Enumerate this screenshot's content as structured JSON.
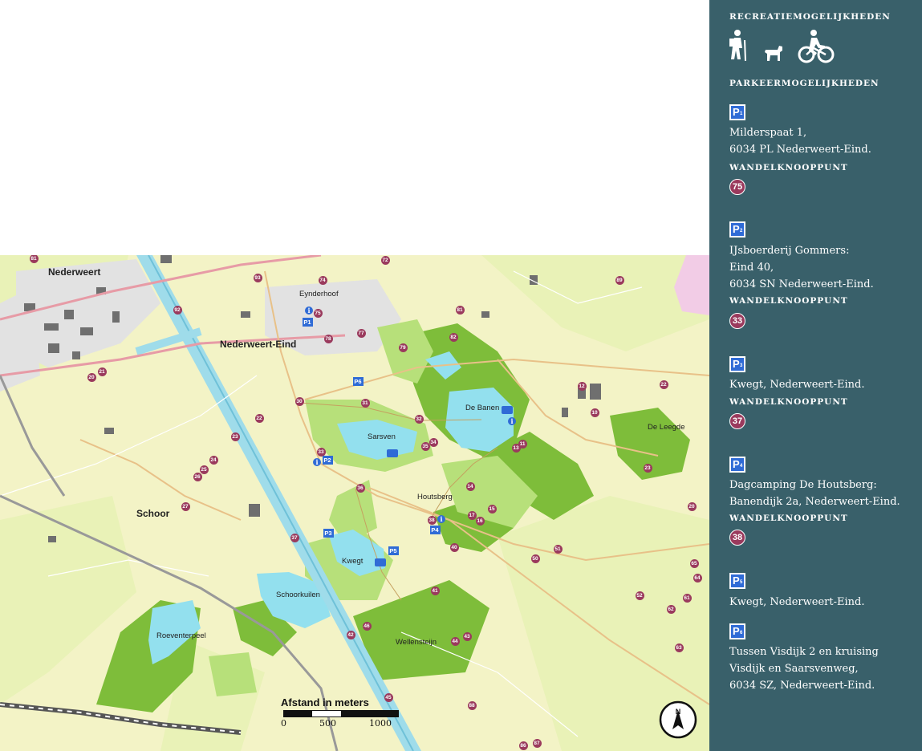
{
  "map": {
    "places": [
      {
        "id": "nederweert",
        "label": "Nederweert"
      },
      {
        "id": "nederweert-eind",
        "label": "Nederweert-Eind"
      },
      {
        "id": "schoor",
        "label": "Schoor"
      },
      {
        "id": "eynderhoof",
        "label": "Eynderhoof"
      },
      {
        "id": "de-banen",
        "label": "De Banen"
      },
      {
        "id": "sarsven",
        "label": "Sarsven"
      },
      {
        "id": "houtsberg",
        "label": "Houtsberg"
      },
      {
        "id": "de-leegde",
        "label": "De Leegde"
      },
      {
        "id": "kwegt",
        "label": "Kwegt"
      },
      {
        "id": "schoorkuilen",
        "label": "Schoorkuilen"
      },
      {
        "id": "roeventerpeel",
        "label": "Roeventerpeel"
      },
      {
        "id": "wellensteijn",
        "label": "Wellensteijn"
      }
    ],
    "nodes": [
      "81",
      "72",
      "93",
      "74",
      "92",
      "75",
      "89",
      "77",
      "78",
      "81",
      "82",
      "79",
      "21",
      "20",
      "31",
      "30",
      "22",
      "32",
      "35",
      "34",
      "33",
      "23",
      "24",
      "25",
      "26",
      "36",
      "27",
      "37",
      "38",
      "40",
      "41",
      "46",
      "42",
      "44",
      "43",
      "45",
      "14",
      "17",
      "16",
      "15",
      "12",
      "10",
      "22",
      "23",
      "13",
      "11",
      "20",
      "51",
      "50",
      "65",
      "52",
      "61",
      "62",
      "64",
      "63",
      "88",
      "86",
      "87",
      "86"
    ],
    "parking_labels": [
      "P1",
      "P6",
      "P2",
      "P3",
      "P5",
      "P4"
    ],
    "scale": {
      "title": "Afstand in meters",
      "ticks": [
        "0",
        "500",
        "1000"
      ]
    },
    "north_label": "N"
  },
  "panel": {
    "recreation_heading": "RECREATIEMOGELIJKHEDEN",
    "recreation_icons": [
      "hiking-icon",
      "dog-walking-icon",
      "cycling-icon"
    ],
    "parking_heading": "PARKEERMOGELIJKHEDEN",
    "node_heading": "WANDELKNOOPPUNT",
    "parkings": [
      {
        "badge": "P",
        "sub": "1",
        "lines": [
          "Milderspaat 1,",
          "6034 PL Nederweert-Eind."
        ],
        "node": "75"
      },
      {
        "badge": "P",
        "sub": "2",
        "lines": [
          "IJsboerderij Gommers:",
          "Eind 40,",
          "6034 SN Nederweert-Eind."
        ],
        "node": "33"
      },
      {
        "badge": "P",
        "sub": "3",
        "lines": [
          "Kwegt, Nederweert-Eind."
        ],
        "node": "37"
      },
      {
        "badge": "P",
        "sub": "4",
        "lines": [
          "Dagcamping De Houtsberg:",
          "Banendijk 2a, Nederweert-Eind."
        ],
        "node": "38"
      },
      {
        "badge": "P",
        "sub": "5",
        "lines": [
          "Kwegt, Nederweert-Eind."
        ],
        "node": ""
      },
      {
        "badge": "P",
        "sub": "6",
        "lines": [
          "Tussen Visdijk 2 en kruising",
          "Visdijk en Saarsvenweg,",
          "6034 SZ, Nederweert-Eind."
        ],
        "node": ""
      }
    ]
  },
  "colors": {
    "panel": "#39606a",
    "node": "#9a3a5d",
    "parking": "#2f6bd6",
    "forest": "#7ebd3a",
    "light_forest": "#b7e07a",
    "water": "#93e0ee",
    "field": "#f3f3c6"
  }
}
